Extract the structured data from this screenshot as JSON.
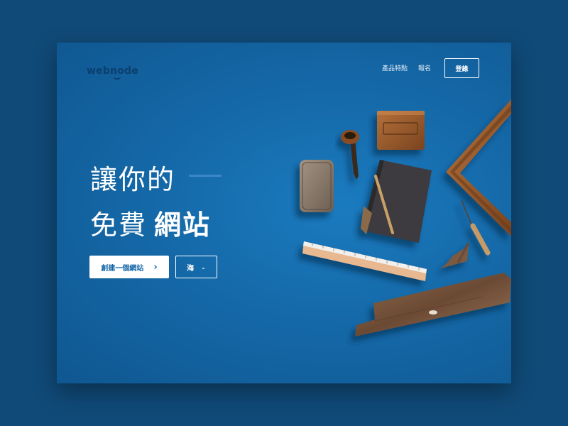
{
  "header": {
    "logo": "webnode",
    "nav": [
      {
        "label": "產品特點"
      },
      {
        "label": "報名"
      }
    ],
    "login_label": "登錄"
  },
  "hero": {
    "line1": "讓你的",
    "line2_regular": "免費",
    "line2_bold": "網站",
    "cta_label": "創建一個網站",
    "cta_chevron": "›",
    "lang_label": "海",
    "lang_chevron": "⌄"
  },
  "colors": {
    "page_bg": "#104a78",
    "card_bg": "#1569a8",
    "logo": "#0b3f6c",
    "accent_dash": "#3b86c6",
    "cta_text": "#1565a6"
  }
}
